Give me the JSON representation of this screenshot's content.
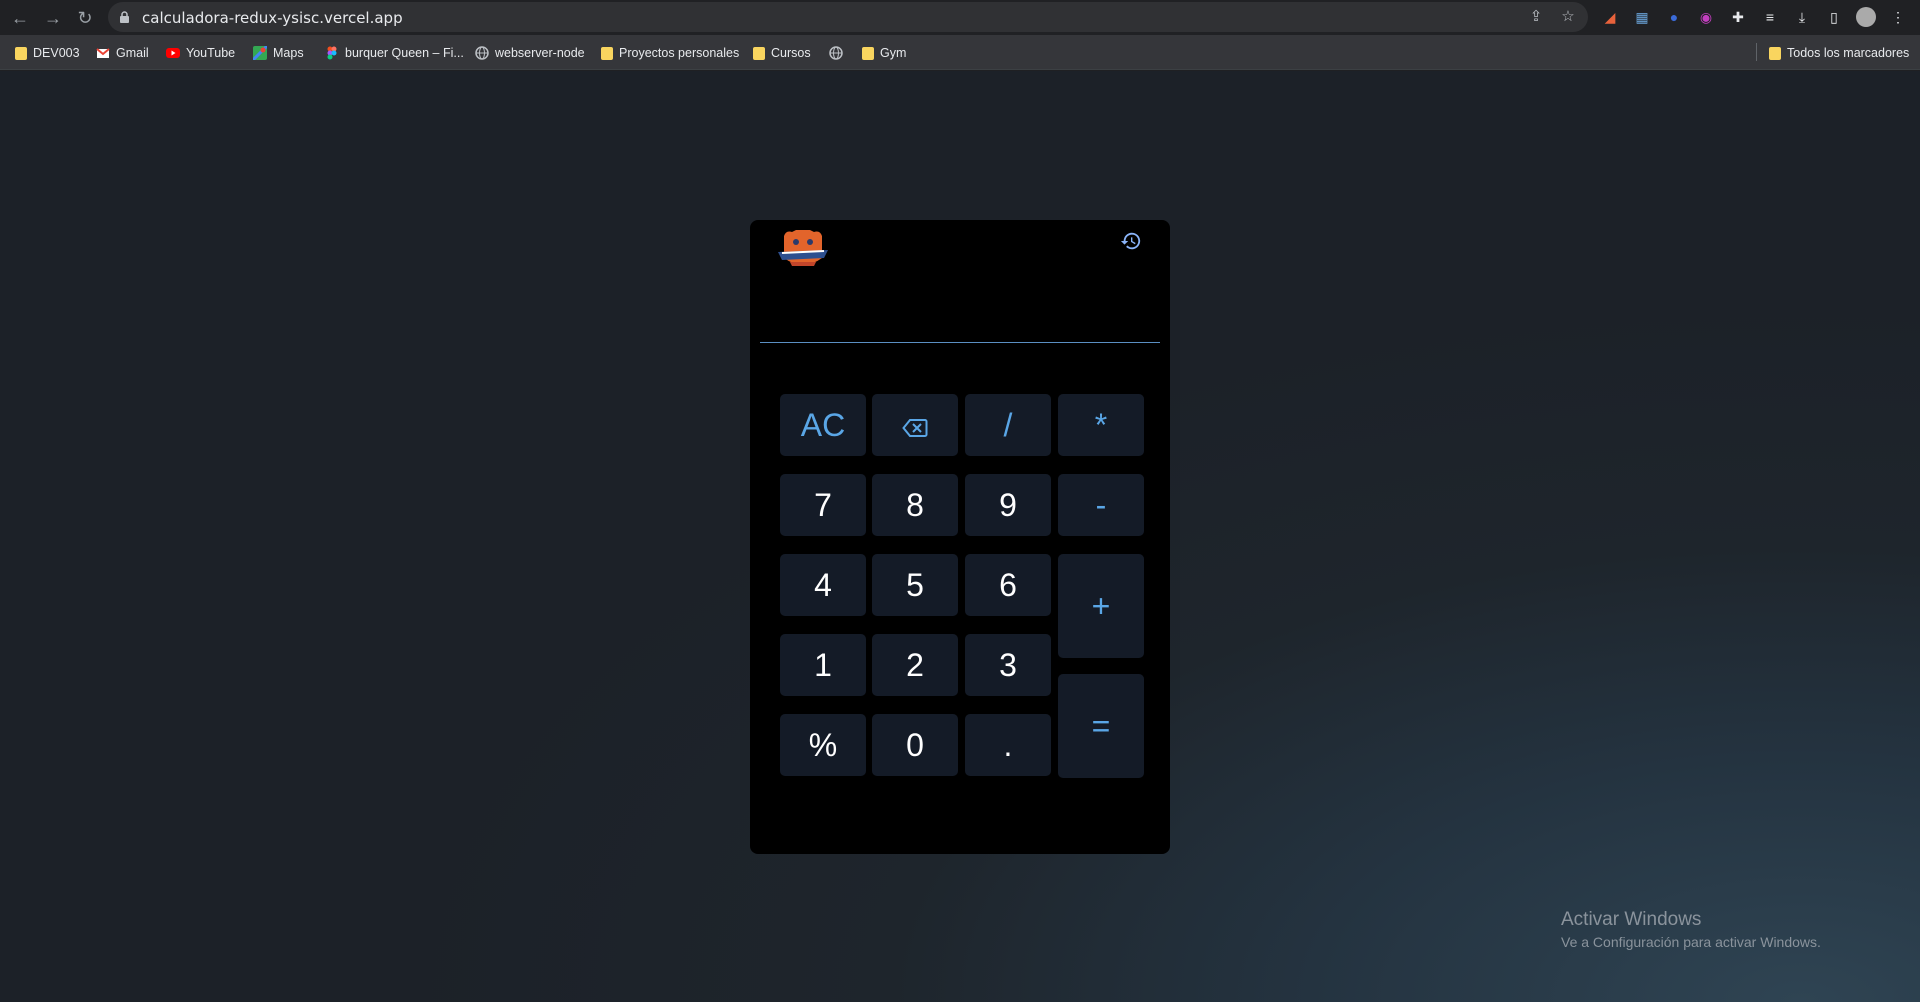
{
  "browser": {
    "url": "calculadora-redux-ysisc.vercel.app",
    "bookmarks": [
      {
        "label": "DEV003",
        "icon": "folder-icon"
      },
      {
        "label": "Gmail",
        "icon": "gmail-icon"
      },
      {
        "label": "YouTube",
        "icon": "youtube-icon"
      },
      {
        "label": "Maps",
        "icon": "maps-icon"
      },
      {
        "label": "burquer Queen – Fi...",
        "icon": "figma-icon"
      },
      {
        "label": "webserver-node",
        "icon": "globe-icon"
      },
      {
        "label": "Proyectos personales",
        "icon": "folder-icon"
      },
      {
        "label": "Cursos",
        "icon": "folder-icon"
      },
      {
        "label": "",
        "icon": "globe-icon"
      },
      {
        "label": "Gym",
        "icon": "folder-icon"
      }
    ],
    "all_bookmarks": "Todos los marcadores"
  },
  "calculator": {
    "display_value": "",
    "keys": {
      "ac": "AC",
      "divide": "/",
      "multiply": "*",
      "seven": "7",
      "eight": "8",
      "nine": "9",
      "minus": "-",
      "four": "4",
      "five": "5",
      "six": "6",
      "plus": "+",
      "one": "1",
      "two": "2",
      "three": "3",
      "equals": "=",
      "percent": "%",
      "zero": "0",
      "dot": "."
    },
    "accent_color": "#5aa6e6"
  },
  "watermark": {
    "title": "Activar Windows",
    "subtitle": "Ve a Configuración para activar Windows."
  }
}
